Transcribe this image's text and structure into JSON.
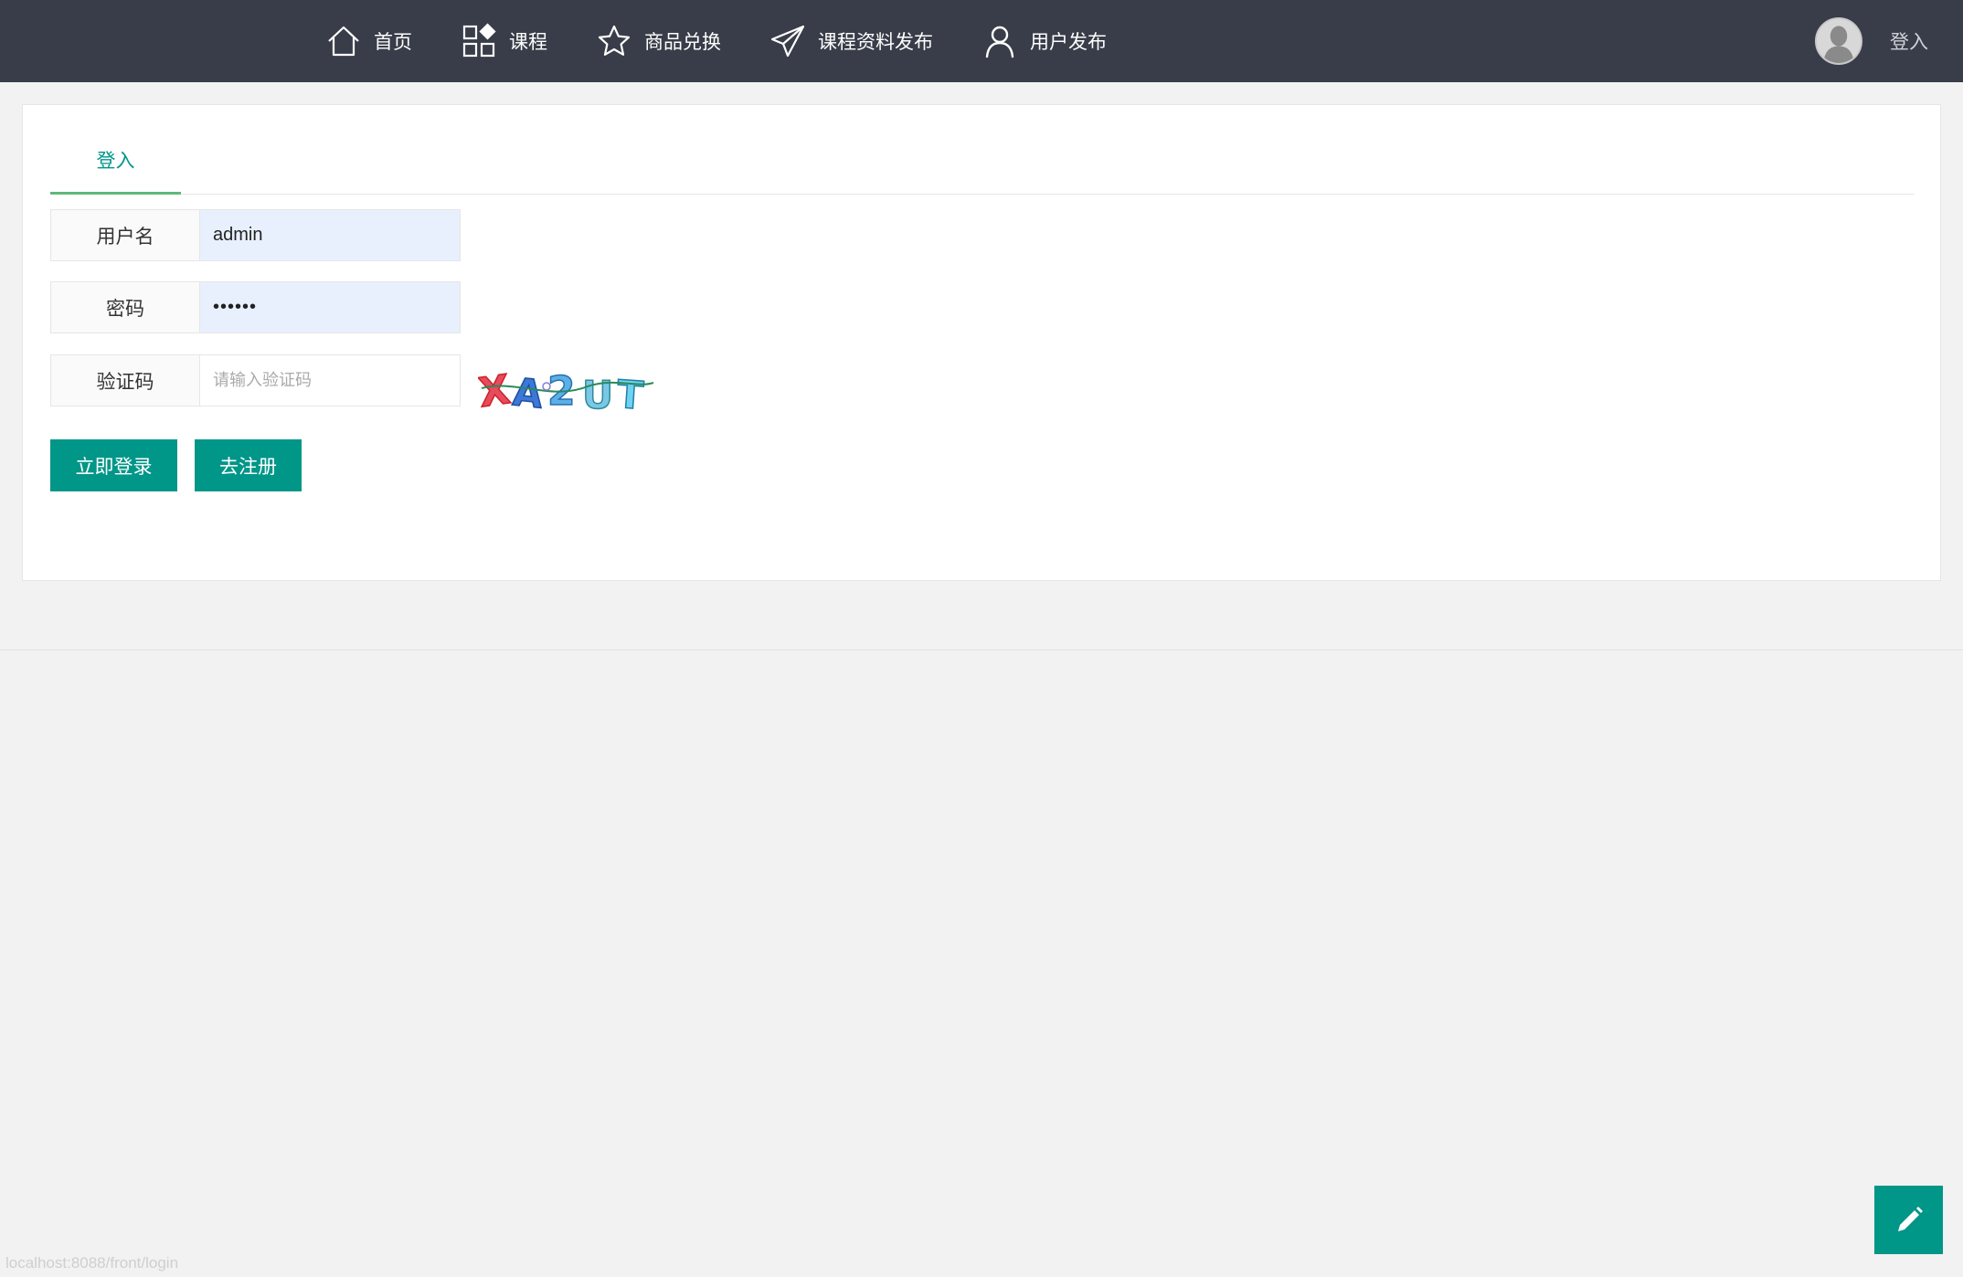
{
  "nav": {
    "items": [
      {
        "label": "首页",
        "icon": "home-icon"
      },
      {
        "label": "课程",
        "icon": "grid-icon"
      },
      {
        "label": "商品兑换",
        "icon": "star-icon"
      },
      {
        "label": "课程资料发布",
        "icon": "paper-plane-icon"
      },
      {
        "label": "用户发布",
        "icon": "user-icon"
      }
    ],
    "login_label": "登入"
  },
  "login_card": {
    "tab_label": "登入",
    "username": {
      "label": "用户名",
      "value": "admin"
    },
    "password": {
      "label": "密码",
      "value": "••••••"
    },
    "captcha": {
      "label": "验证码",
      "placeholder": "请输入验证码",
      "image_text": "XA2UT"
    },
    "submit_label": "立即登录",
    "register_label": "去注册"
  },
  "status_bar": {
    "url": "localhost:8088/front/login"
  },
  "colors": {
    "topbar": "#393d49",
    "accent": "#009688",
    "tab_underline": "#5fb878"
  }
}
